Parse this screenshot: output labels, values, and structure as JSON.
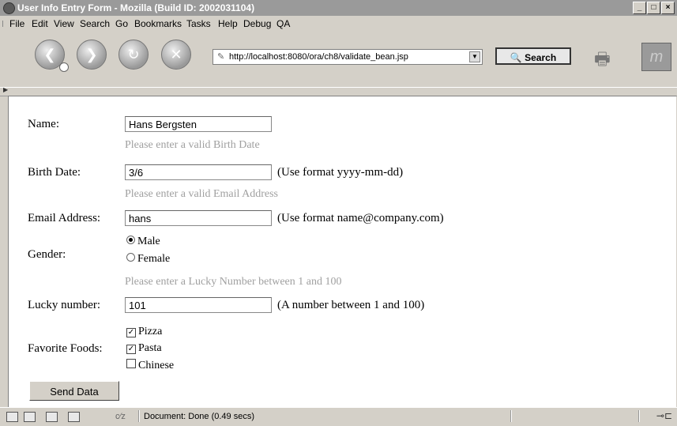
{
  "window": {
    "title": "User Info Entry Form - Mozilla (Build ID: 2002031104)"
  },
  "menu": [
    "File",
    "Edit",
    "View",
    "Search",
    "Go",
    "Bookmarks",
    "Tasks",
    "Help",
    "Debug",
    "QA"
  ],
  "navbar": {
    "url": "http://localhost:8080/ora/ch8/validate_bean.jsp",
    "search_label": "Search"
  },
  "form": {
    "name_label": "Name:",
    "name_value": "Hans Bergsten",
    "birth_error": "Please enter a valid Birth Date",
    "birth_label": "Birth Date:",
    "birth_value": "3/6",
    "birth_hint": "(Use format yyyy-mm-dd)",
    "email_error": "Please enter a valid Email Address",
    "email_label": "Email Address:",
    "email_value": "hans",
    "email_hint": "(Use format name@company.com)",
    "gender_label": "Gender:",
    "gender_male": "Male",
    "gender_female": "Female",
    "lucky_error": "Please enter a Lucky Number between 1 and 100",
    "lucky_label": "Lucky number:",
    "lucky_value": "101",
    "lucky_hint": "(A number between 1 and 100)",
    "foods_label": "Favorite Foods:",
    "food_pizza": "Pizza",
    "food_pasta": "Pasta",
    "food_chinese": "Chinese",
    "send_button": "Send Data"
  },
  "statusbar": {
    "message": "Document: Done (0.49 secs)"
  }
}
